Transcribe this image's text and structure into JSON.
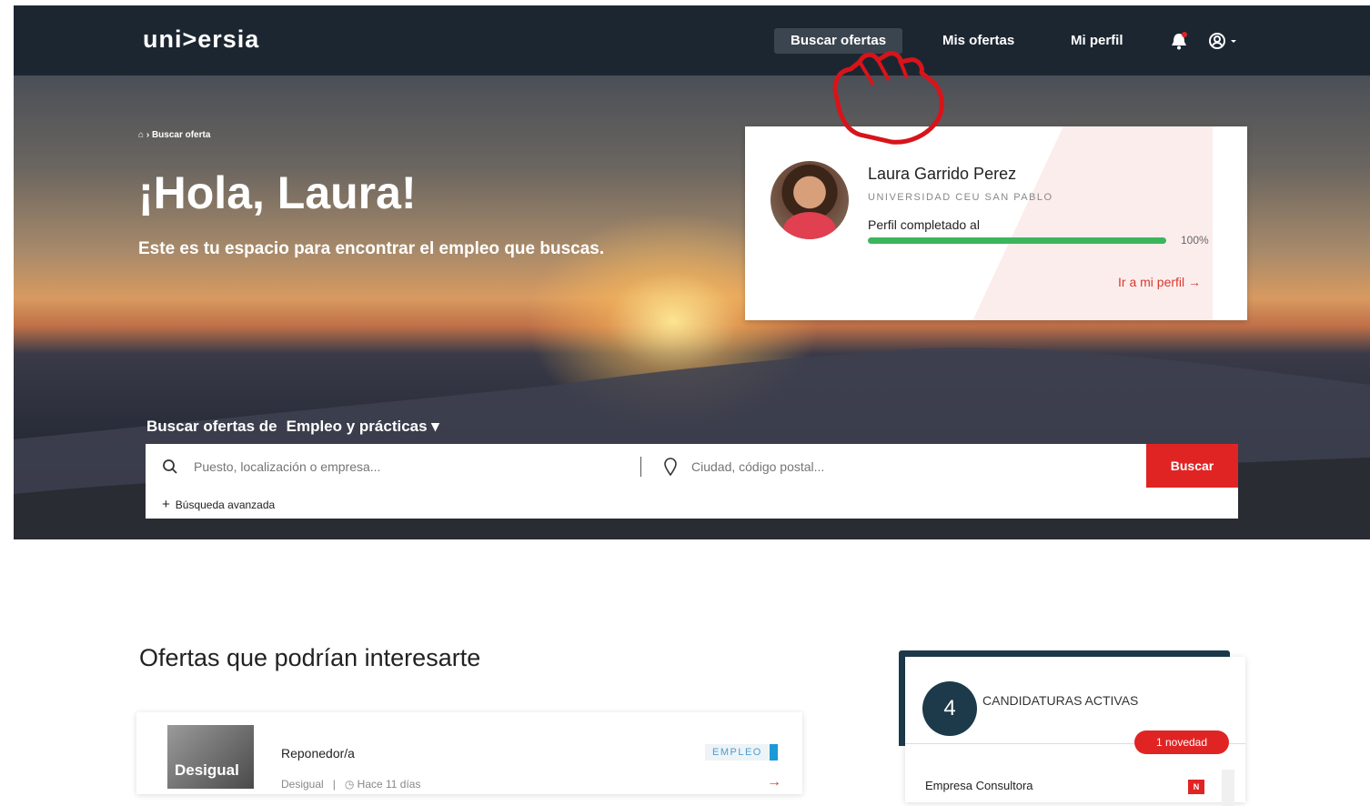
{
  "header": {
    "logo": "uni>ersia",
    "nav": [
      {
        "label": "Buscar ofertas",
        "active": true
      },
      {
        "label": "Mis ofertas",
        "active": false
      },
      {
        "label": "Mi perfil",
        "active": false
      }
    ],
    "icons": [
      "bell-icon",
      "user-account-icon"
    ]
  },
  "hero": {
    "breadcrumb": "Buscar oferta",
    "greeting": "¡Hola, Laura!",
    "subtitle": "Este es tu espacio para encontrar el empleo que buscas."
  },
  "profile": {
    "name": "Laura Garrido Perez",
    "university": "UNIVERSIDAD CEU SAN PABLO",
    "completion_label": "Perfil completado al",
    "completion_value": 100,
    "completion_text": "100%",
    "link": "Ir a mi perfil →"
  },
  "search": {
    "label_prefix": "Buscar ofertas de",
    "label_type": "Empleo y prácticas ▾",
    "query_placeholder": "Puesto, localización o empresa...",
    "city_placeholder": "Ciudad, código postal...",
    "button": "Buscar",
    "advanced": "Búsqueda avanzada"
  },
  "offers": {
    "title": "Ofertas que podrían interesarte",
    "items": [
      {
        "logo": "Desigual",
        "title": "Reponedor/a",
        "company": "Desigual",
        "time": "Hace 11 días",
        "badge": "EMPLEO"
      }
    ]
  },
  "candidaturas": {
    "count": "4",
    "label": "CANDIDATURAS ACTIVAS",
    "novedad": "1 novedad",
    "items": [
      {
        "company": "Empresa Consultora",
        "badge": "N"
      }
    ]
  },
  "colors": {
    "topbar": "#1c2631",
    "accent": "#e02424",
    "progress": "#3db55d",
    "badge_blue": "#1a9ad7"
  }
}
